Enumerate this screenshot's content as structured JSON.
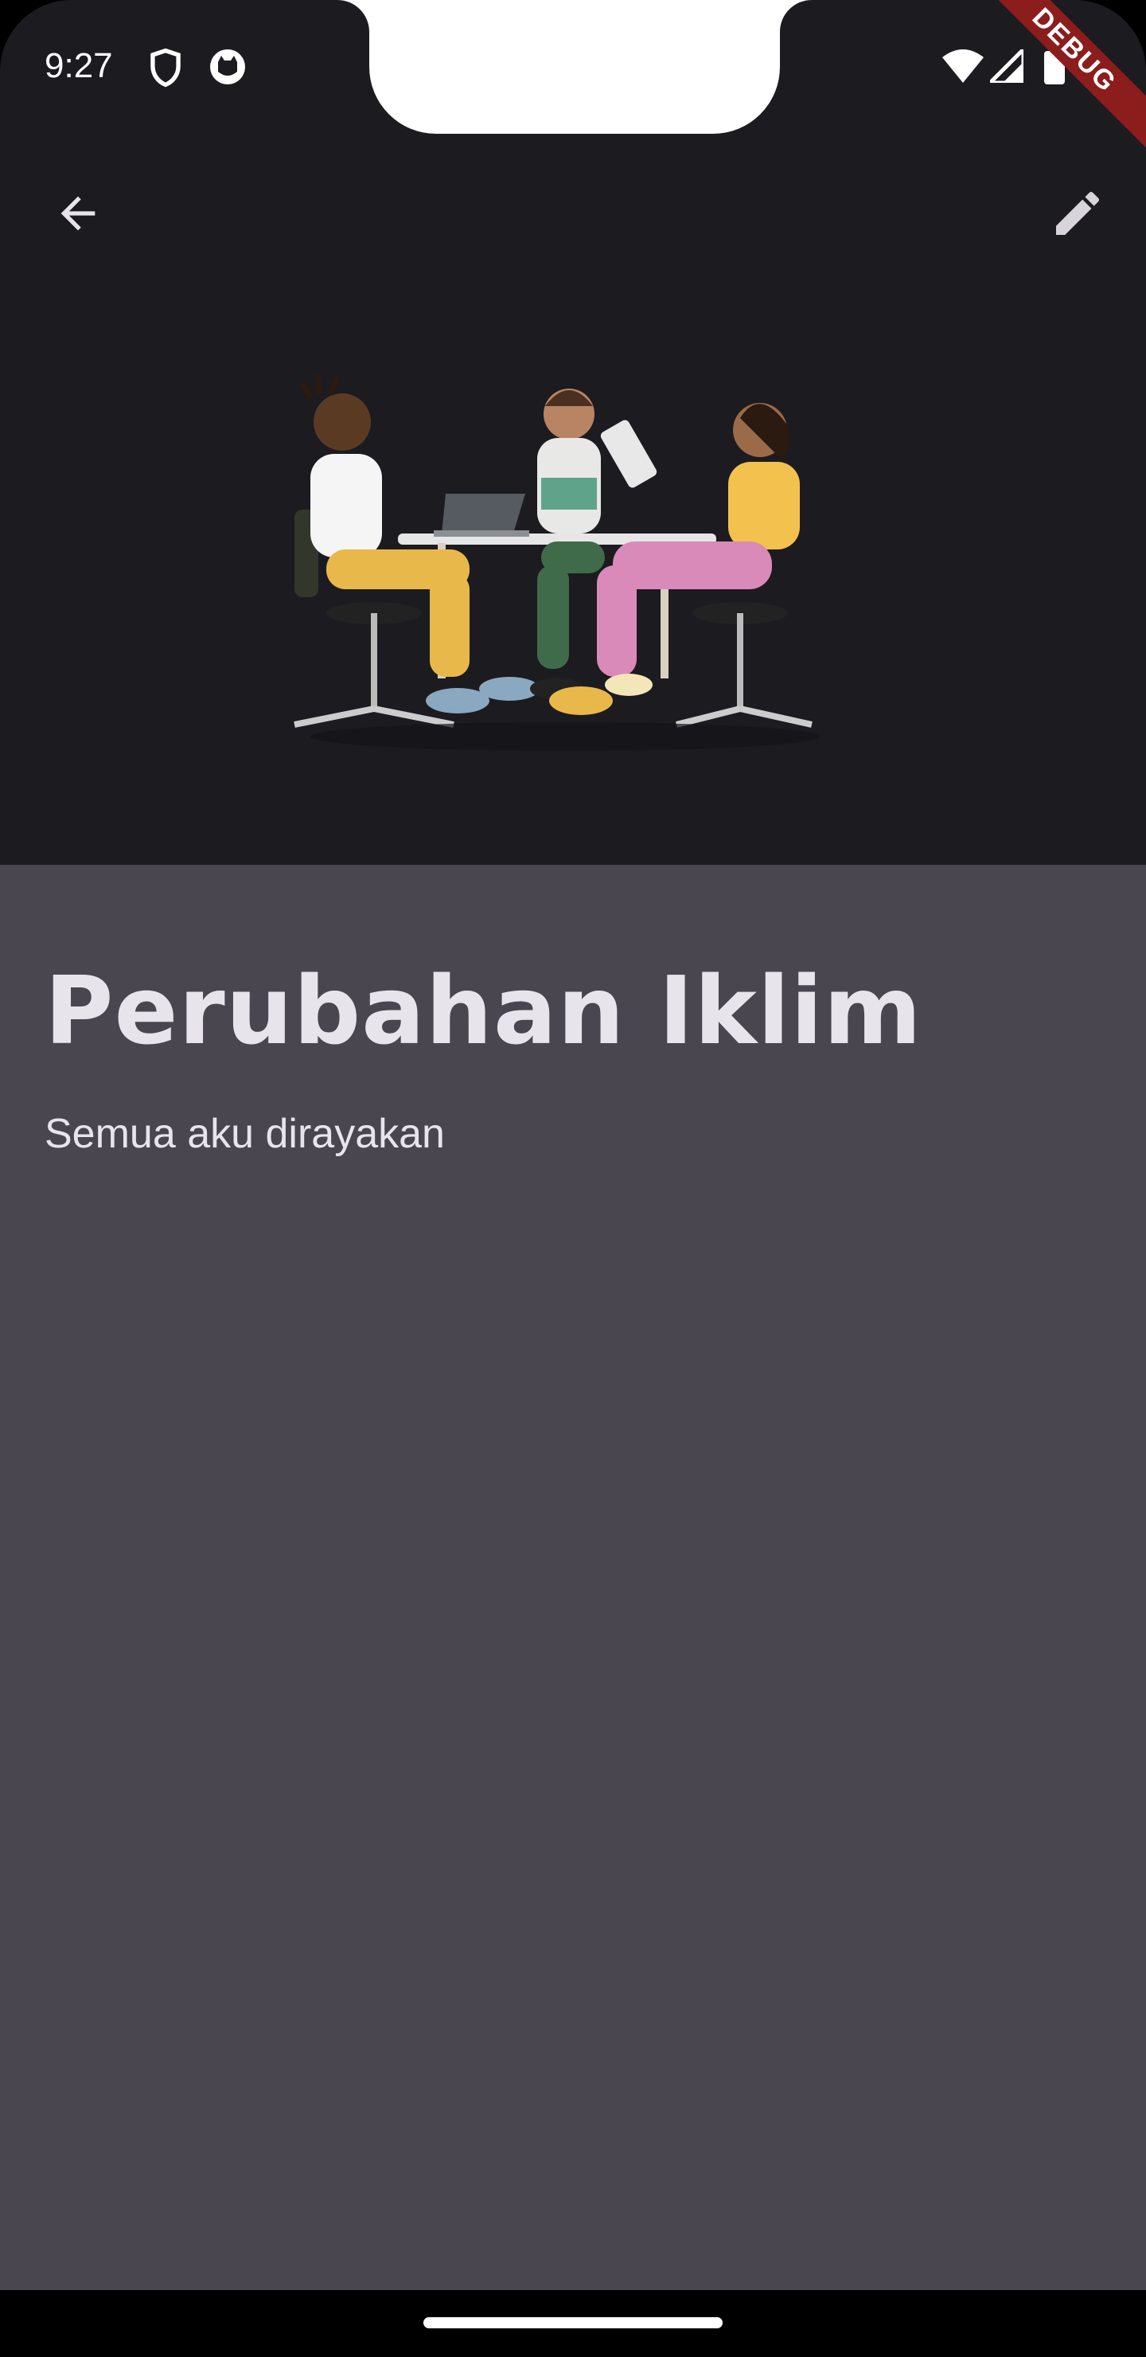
{
  "status_bar": {
    "time": "9:27",
    "icons": [
      "shield-icon",
      "cat-icon",
      "wifi-icon",
      "signal-icon",
      "battery-icon"
    ]
  },
  "debug_banner": "DEBUG",
  "app_bar": {
    "back_icon": "arrow-back-icon",
    "edit_icon": "pencil-icon"
  },
  "hero": {
    "image": "illustration-three-people-meeting-at-table"
  },
  "detail": {
    "title": "Perubahan Iklim",
    "subtitle": "Semua aku dirayakan"
  },
  "colors": {
    "header_bg": "#1c1b20",
    "content_bg": "#4a4650",
    "text": "#e8e4ec"
  }
}
